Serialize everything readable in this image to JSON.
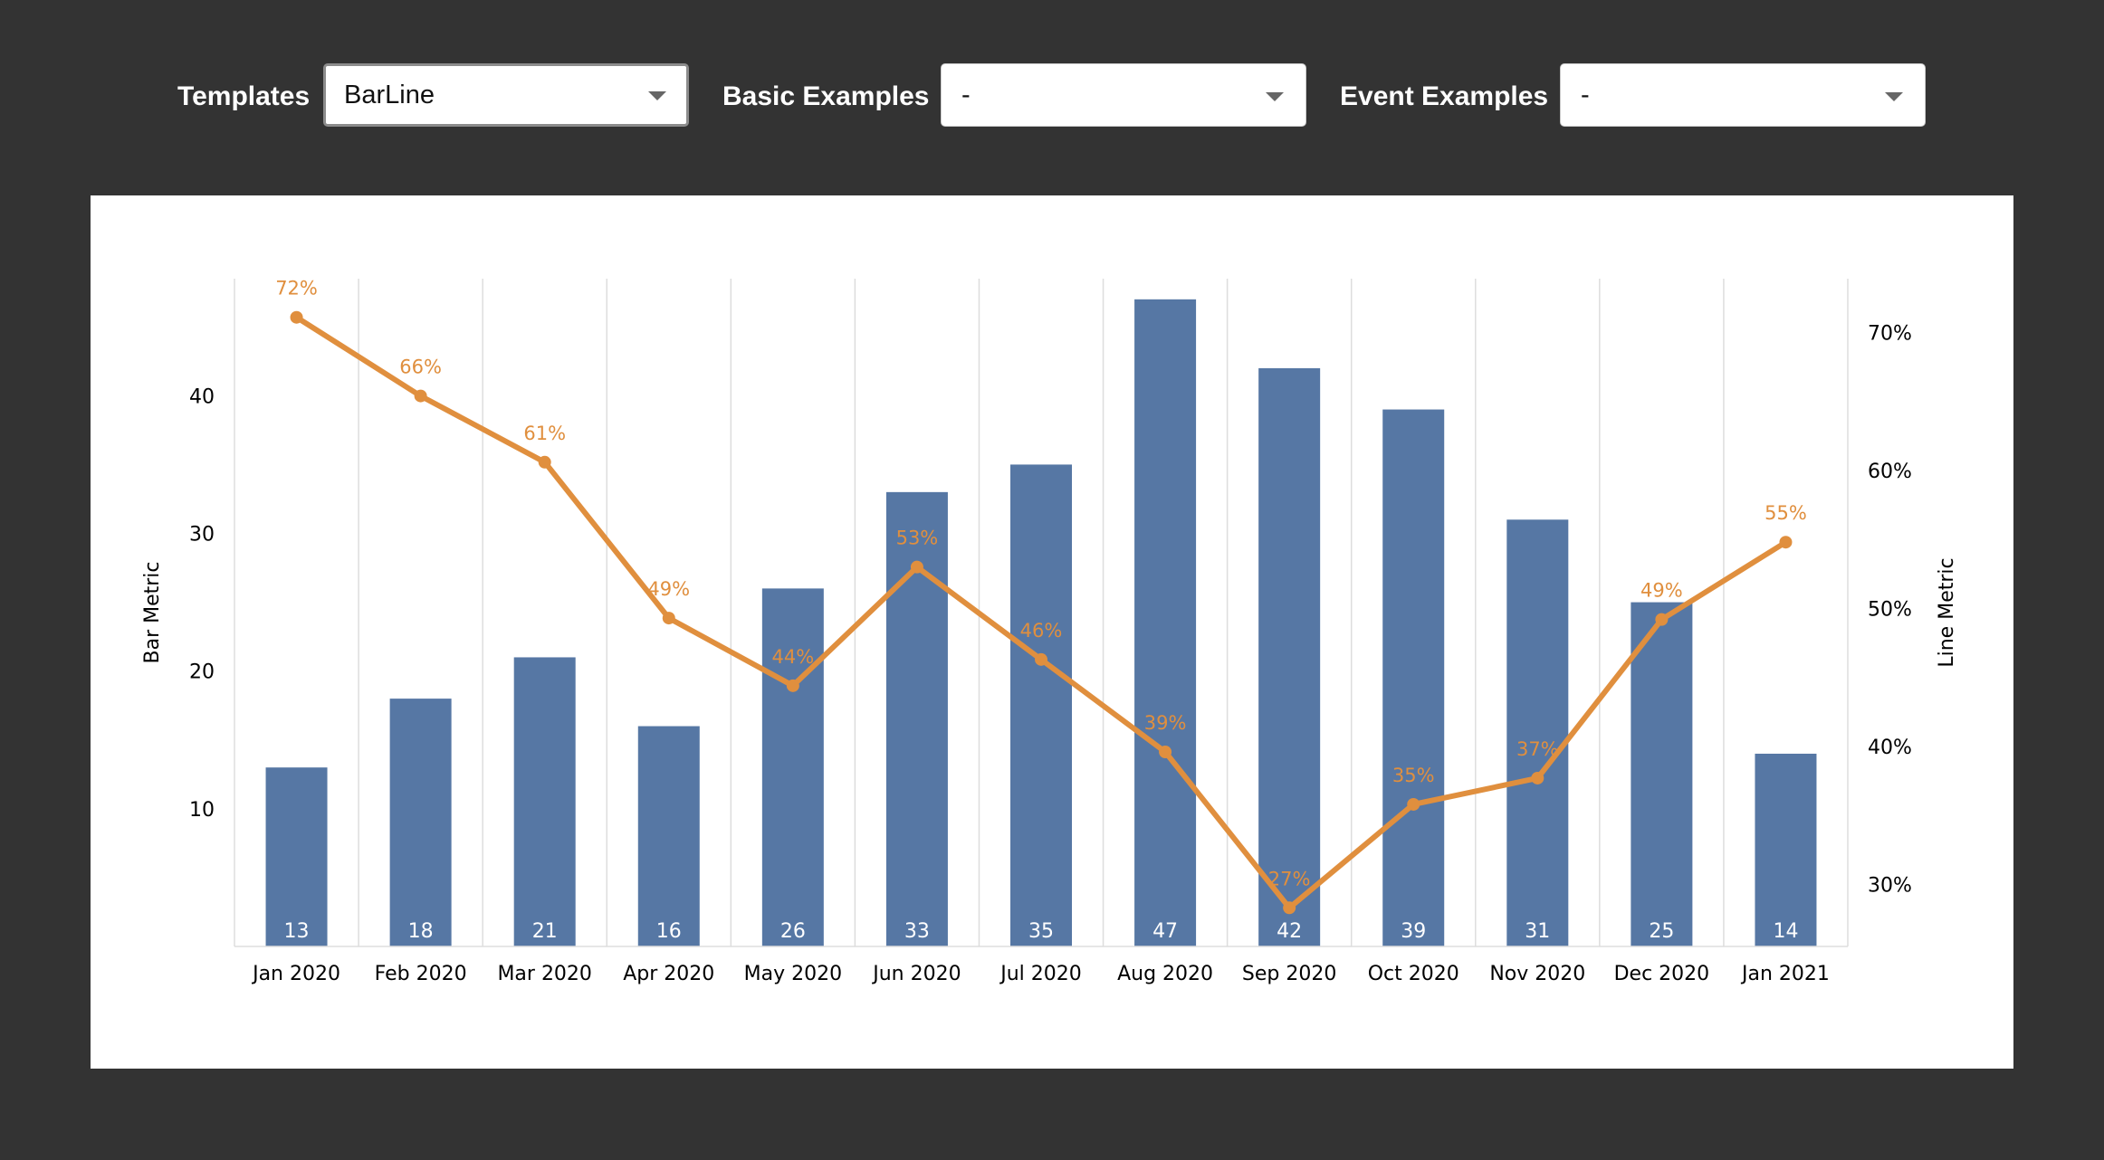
{
  "controls": {
    "templates": {
      "label": "Templates",
      "value": "BarLine"
    },
    "basic_examples": {
      "label": "Basic Examples",
      "value": "-"
    },
    "event_examples": {
      "label": "Event Examples",
      "value": "-"
    }
  },
  "colors": {
    "bar": "#5677a4",
    "line": "#e08f3e",
    "grid": "#dddddd",
    "background": "#333333",
    "panel": "#ffffff"
  },
  "chart_data": {
    "type": "bar",
    "title": "",
    "xlabel": "",
    "ylabel": "Bar Metric",
    "y2label": "Line Metric",
    "categories": [
      "Jan 2020",
      "Feb 2020",
      "Mar 2020",
      "Apr 2020",
      "May 2020",
      "Jun 2020",
      "Jul 2020",
      "Aug 2020",
      "Sep 2020",
      "Oct 2020",
      "Nov 2020",
      "Dec 2020",
      "Jan 2021"
    ],
    "ylim": [
      0,
      48.5
    ],
    "y_ticks": [
      10,
      20,
      30,
      40
    ],
    "y2lim": [
      25.5,
      73.9
    ],
    "y2_ticks": [
      30,
      40,
      50,
      60,
      70
    ],
    "y2_tick_labels": [
      "30%",
      "40%",
      "50%",
      "60%",
      "70%"
    ],
    "grid": "vertical",
    "series": [
      {
        "type": "bar",
        "axis": "left",
        "values": [
          13,
          18,
          21,
          16,
          26,
          33,
          35,
          47,
          42,
          39,
          31,
          25,
          14
        ],
        "labels": [
          "13",
          "18",
          "21",
          "16",
          "26",
          "33",
          "35",
          "47",
          "42",
          "39",
          "31",
          "25",
          "14"
        ]
      },
      {
        "type": "line",
        "axis": "right",
        "values": [
          71.1,
          65.4,
          60.6,
          49.3,
          44.4,
          53.0,
          46.3,
          39.6,
          28.3,
          35.8,
          37.7,
          49.2,
          54.8
        ],
        "labels": [
          "72%",
          "66%",
          "61%",
          "49%",
          "44%",
          "53%",
          "46%",
          "39%",
          "27%",
          "35%",
          "37%",
          "49%",
          "55%"
        ]
      }
    ]
  }
}
